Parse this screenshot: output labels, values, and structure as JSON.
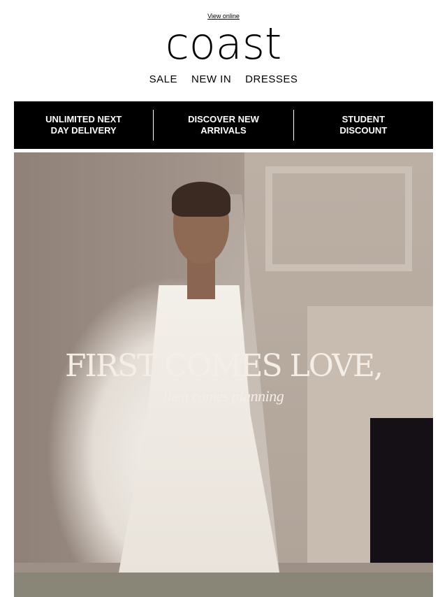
{
  "header": {
    "view_online": "View online",
    "logo": "coast"
  },
  "nav": {
    "items": [
      "SALE",
      "NEW IN",
      "DRESSES"
    ]
  },
  "promo": {
    "items": [
      "UNLIMITED NEXT\nDAY DELIVERY",
      "DISCOVER NEW\nARRIVALS",
      "STUDENT\nDISCOUNT"
    ]
  },
  "hero": {
    "title": "FIRST COMES LOVE,",
    "subtitle": "then comes planning"
  },
  "colors": {
    "promo_bg": "#000000",
    "footer_bg": "#8a8677",
    "hero_text": "#f4eee6"
  }
}
